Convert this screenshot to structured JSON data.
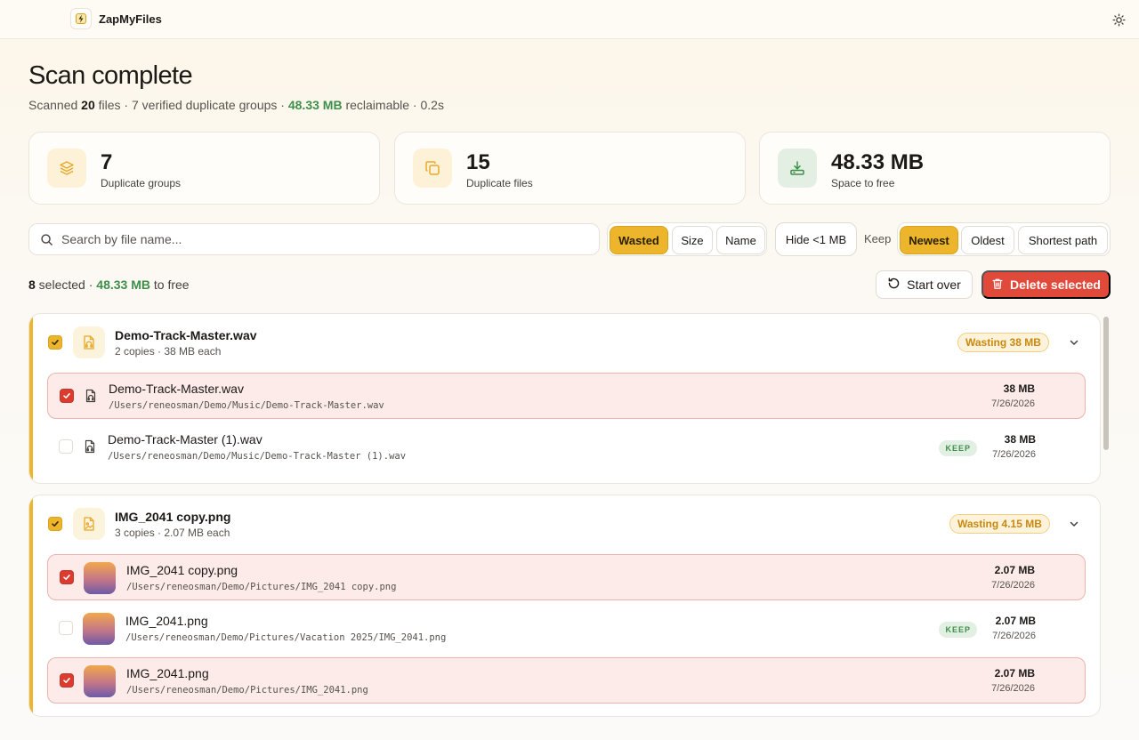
{
  "app": {
    "name": "ZapMyFiles",
    "icons": {
      "logo": "lightning-logo-icon",
      "theme": "sun-icon"
    }
  },
  "header": {
    "title": "Scan complete",
    "subtitle": {
      "scanned_prefix": "Scanned ",
      "file_count": "20",
      "files_suffix": " files · 7 verified duplicate groups · ",
      "reclaimable_size": "48.33 MB",
      "reclaimable_suffix": " reclaimable · 0.2s"
    }
  },
  "stats": [
    {
      "value": "7",
      "label": "Duplicate groups",
      "icon": "layers-icon",
      "color": "#e8a92a"
    },
    {
      "value": "15",
      "label": "Duplicate files",
      "icon": "copy-icon",
      "color": "#e8a92a"
    },
    {
      "value": "48.33 MB",
      "label": "Space to free",
      "icon": "download-drive-icon",
      "color": "#3f8f4a"
    }
  ],
  "toolbar": {
    "search_placeholder": "Search by file name...",
    "sort_options": [
      "Wasted",
      "Size",
      "Name"
    ],
    "sort_selected": "Wasted",
    "filter_label": "Hide <1 MB",
    "keep_label": "Keep",
    "keep_options": [
      "Newest",
      "Oldest",
      "Shortest path"
    ],
    "keep_selected": "Newest"
  },
  "selection": {
    "count": "8",
    "selected_text": " selected · ",
    "size": "48.33 MB",
    "to_free_text": " to free",
    "start_over_label": "Start over",
    "delete_label": "Delete selected"
  },
  "groups": [
    {
      "name": "Demo-Track-Master.wav",
      "meta": "2 copies · 38 MB each",
      "badge": "Wasting 38 MB",
      "icon": "audio-file-icon",
      "files": [
        {
          "name": "Demo-Track-Master.wav",
          "path": "/Users/reneosman/Demo/Music/Demo-Track-Master.wav",
          "size": "38 MB",
          "date": "7/26/2026",
          "selected": true
        },
        {
          "name": "Demo-Track-Master (1).wav",
          "path": "/Users/reneosman/Demo/Music/Demo-Track-Master (1).wav",
          "size": "38 MB",
          "date": "7/26/2026",
          "selected": false,
          "keep": "KEEP"
        }
      ]
    },
    {
      "name": "IMG_2041 copy.png",
      "meta": "3 copies · 2.07 MB each",
      "badge": "Wasting 4.15 MB",
      "icon": "image-file-icon",
      "files": [
        {
          "name": "IMG_2041 copy.png",
          "path": "/Users/reneosman/Demo/Pictures/IMG_2041 copy.png",
          "size": "2.07 MB",
          "date": "7/26/2026",
          "selected": true
        },
        {
          "name": "IMG_2041.png",
          "path": "/Users/reneosman/Demo/Pictures/Vacation 2025/IMG_2041.png",
          "size": "2.07 MB",
          "date": "7/26/2026",
          "selected": false,
          "keep": "KEEP"
        },
        {
          "name": "IMG_2041.png",
          "path": "/Users/reneosman/Demo/Pictures/IMG_2041.png",
          "size": "2.07 MB",
          "date": "7/26/2026",
          "selected": true
        }
      ]
    }
  ]
}
